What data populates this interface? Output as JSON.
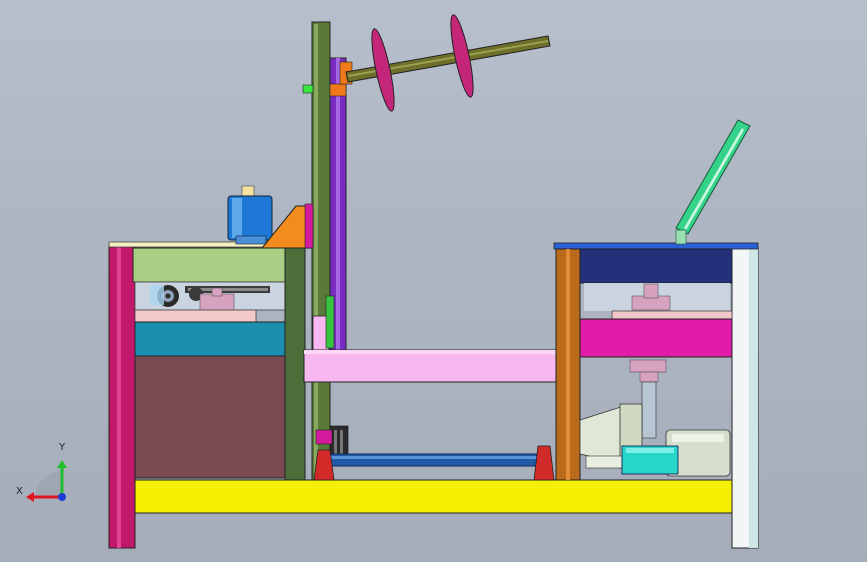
{
  "window": {
    "title": ""
  },
  "view": {
    "type": "cad-3d-viewport",
    "background_top": "#b7bfcc",
    "background_bottom": "#a5adba",
    "triad": {
      "x_label": "X",
      "y_label": "Y",
      "x_color": "#e0141e",
      "y_color": "#1fbf2a",
      "z_color": "#1a3bd6"
    }
  },
  "model": {
    "name": "",
    "parts": [
      {
        "id": "base-yellow-beam",
        "color": "#f4f000"
      },
      {
        "id": "left-magenta-post",
        "color": "#c2186b"
      },
      {
        "id": "right-white-post",
        "color": "#f2f6f6"
      },
      {
        "id": "left-frame-top-green",
        "color": "#a9cf84"
      },
      {
        "id": "left-teal-block",
        "color": "#1a8fb0"
      },
      {
        "id": "left-brown-box",
        "color": "#7a4a52"
      },
      {
        "id": "tall-olive-column",
        "color": "#5a7a3a"
      },
      {
        "id": "purple-belt-pulley",
        "color": "#7a2bc4"
      },
      {
        "id": "diagonal-shaft",
        "color": "#6d6f2a"
      },
      {
        "id": "magenta-disc",
        "color": "#c4267a"
      },
      {
        "id": "blue-cylinder-motor",
        "color": "#1e78d6"
      },
      {
        "id": "orange-bracket",
        "color": "#f28c1c"
      },
      {
        "id": "pink-crossbeam",
        "color": "#f7b8f0"
      },
      {
        "id": "bottom-blue-shaft",
        "color": "#1f5aa6"
      },
      {
        "id": "red-bearing-blocks",
        "color": "#d22a28"
      },
      {
        "id": "right-navy-block",
        "color": "#23307a"
      },
      {
        "id": "right-magenta-plate",
        "color": "#e01ca8"
      },
      {
        "id": "right-brown-post",
        "color": "#b96a1a"
      },
      {
        "id": "motor-grey-body",
        "color": "#cfd9c2"
      },
      {
        "id": "cyan-coupling",
        "color": "#26d6c8"
      },
      {
        "id": "green-lever-arm",
        "color": "#33d38a"
      }
    ]
  }
}
